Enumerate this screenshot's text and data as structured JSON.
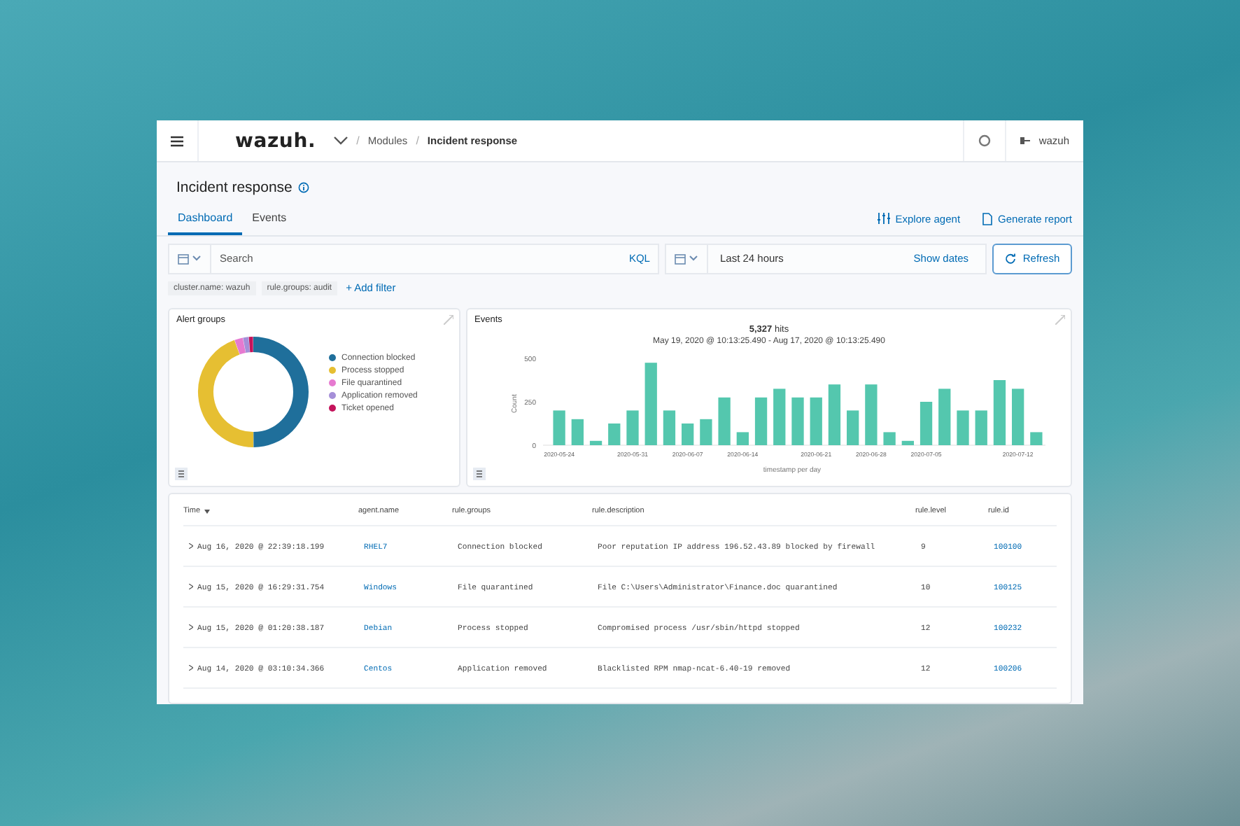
{
  "header": {
    "logo": "wazuh.",
    "breadcrumbs": [
      {
        "label": "Modules",
        "current": false
      },
      {
        "label": "Incident response",
        "current": true
      }
    ],
    "separator": "/",
    "user": "wazuh"
  },
  "page_title": "Incident response",
  "tabs": [
    {
      "label": "Dashboard",
      "selected": true
    },
    {
      "label": "Events",
      "selected": false
    }
  ],
  "actions": [
    {
      "kind": "explore",
      "label": "Explore agent"
    },
    {
      "kind": "report",
      "label": "Generate report"
    }
  ],
  "search": {
    "placeholder": "Search",
    "language": "KQL"
  },
  "date_picker": {
    "value": "Last 24 hours",
    "show_dates": "Show dates"
  },
  "refresh_button": "Refresh",
  "filters": [
    "cluster.name: wazuh",
    "rule.groups: audit"
  ],
  "add_filter": "+ Add filter",
  "alert_groups": {
    "title": "Alert groups",
    "legend": [
      {
        "label": "Connection blocked",
        "color": "#1f6f9b"
      },
      {
        "label": "Process stopped",
        "color": "#e6bf32"
      },
      {
        "label": "File quarantined",
        "color": "#e67ad0"
      },
      {
        "label": "Application removed",
        "color": "#a58fd8"
      },
      {
        "label": "Ticket opened",
        "color": "#c4135b"
      }
    ]
  },
  "events": {
    "title": "Events",
    "hits": "5,327",
    "hits_label": "hits",
    "range": "May 19, 2020 @ 10:13:25.490 - Aug 17, 2020 @ 10:13:25.490",
    "chart_data": {
      "type": "bar",
      "xlabel": "timestamp per day",
      "ylabel": "Count",
      "categories": [
        "2020-05-24",
        null,
        null,
        null,
        "2020-05-31",
        null,
        null,
        "2020-06-07",
        null,
        null,
        "2020-06-14",
        null,
        null,
        null,
        "2020-06-21",
        null,
        null,
        "2020-06-28",
        null,
        null,
        "2020-07-05",
        null,
        null,
        null,
        null,
        "2020-07-12",
        null
      ],
      "values": [
        200,
        150,
        25,
        125,
        200,
        475,
        200,
        125,
        150,
        275,
        75,
        275,
        325,
        275,
        275,
        350,
        200,
        350,
        75,
        25,
        250,
        325,
        200,
        200,
        375,
        325,
        75
      ],
      "ylim": [
        0,
        500
      ],
      "yticks": [
        0,
        250,
        500
      ]
    }
  },
  "table": {
    "columns": [
      {
        "label": "Time",
        "sorted": true
      },
      {
        "label": "agent.name",
        "sorted": false
      },
      {
        "label": "rule.groups",
        "sorted": false
      },
      {
        "label": "rule.description",
        "sorted": false
      },
      {
        "label": "rule.level",
        "sorted": false
      },
      {
        "label": "rule.id",
        "sorted": false
      }
    ],
    "rows": [
      {
        "time": "Aug 16, 2020 @ 22:39:18.199",
        "agent": "RHEL7",
        "group": "Connection blocked",
        "description": "Poor reputation IP address 196.52.43.89 blocked by firewall",
        "level": "9",
        "id": "100100"
      },
      {
        "time": "Aug 15, 2020 @ 16:29:31.754",
        "agent": "Windows",
        "group": "File quarantined",
        "description": "File C:\\Users\\Administrator\\Finance.doc quarantined",
        "level": "10",
        "id": "100125"
      },
      {
        "time": "Aug 15, 2020 @ 01:20:38.187",
        "agent": "Debian",
        "group": "Process stopped",
        "description": "Compromised process /usr/sbin/httpd stopped",
        "level": "12",
        "id": "100232"
      },
      {
        "time": "Aug 14, 2020 @ 03:10:34.366",
        "agent": "Centos",
        "group": "Application removed",
        "description": "Blacklisted RPM nmap-ncat-6.40-19 removed",
        "level": "12",
        "id": "100206"
      }
    ]
  }
}
